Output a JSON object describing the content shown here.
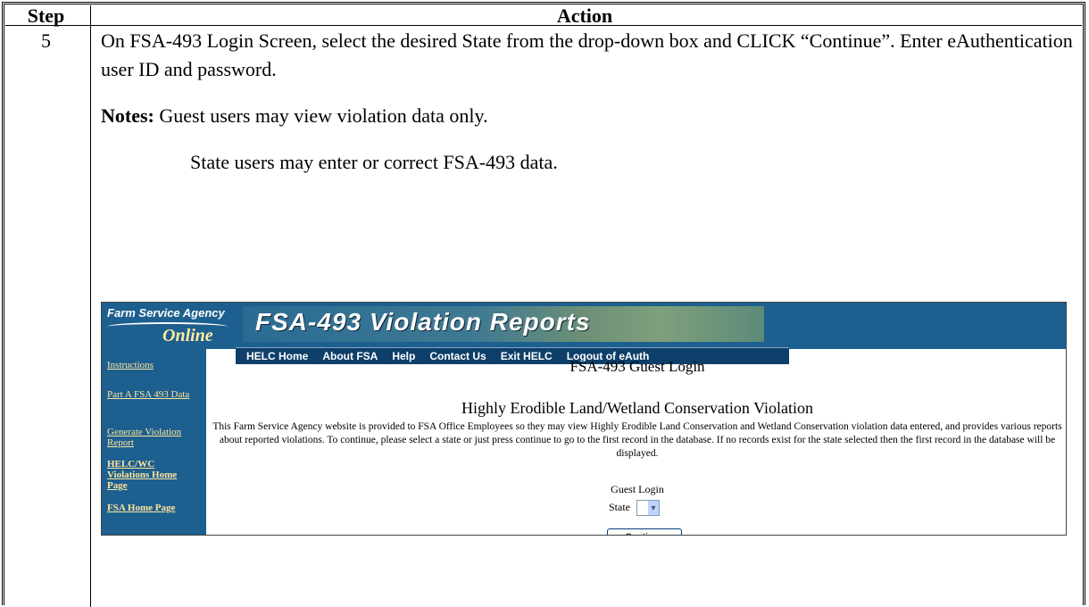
{
  "table": {
    "header_step": "Step",
    "header_action": "Action",
    "step_number": "5",
    "paragraph": "On FSA-493 Login Screen, select the desired State from the drop-down box and CLICK “Continue”.  Enter eAuthentication user ID and password.",
    "notes_label": "Notes:",
    "notes_text": " Guest users may view violation data only.",
    "notes_text2": "State users may enter or correct FSA-493 data."
  },
  "screenshot": {
    "logo_top": "Farm Service Agency",
    "logo_bottom": "Online",
    "title": "FSA-493 Violation Reports",
    "nav": [
      "HELC Home",
      "About FSA",
      "Help",
      "Contact Us",
      "Exit HELC",
      "Logout of eAuth"
    ],
    "sidebar": [
      "Instructions",
      "Part A FSA 493 Data",
      "Generate Violation Report",
      "HELC/WC Violations Home Page",
      "FSA Home Page"
    ],
    "page_title": "FSA-493 Guest Login",
    "subtitle": "Highly Erodible Land/Wetland Conservation Violation",
    "description": "This Farm Service Agency website is provided to FSA Office Employees so they may view Highly Erodible Land Conservation and Wetland Conservation violation data entered, and provides various reports about reported violations. To continue, please select a state or just press continue to go to the first record in the database. If no records exist for the state selected then the first record in the database will be displayed.",
    "guest_login_label": "Guest Login",
    "state_label": "State",
    "state_value": "",
    "continue_label": "Continue"
  }
}
